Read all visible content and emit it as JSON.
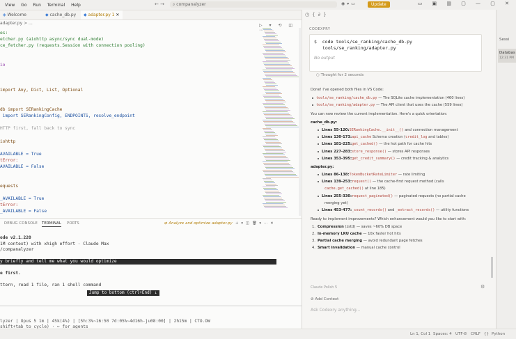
{
  "menu": [
    "View",
    "Go",
    "Run",
    "Terminal",
    "Help"
  ],
  "search_placeholder": "companalyzer",
  "update_label": "Update",
  "tabs": [
    {
      "label": "Welcome"
    },
    {
      "label": "cache_db.py"
    },
    {
      "label": "adapter.py 1",
      "active": true
    }
  ],
  "breadcrumb": "adapter.py > ...",
  "editor_lines": [
    {
      "t": "es:",
      "c": "#2e7d32"
    },
    {
      "t": "etcher.py (aiohttp async/sync dual-mode)",
      "c": "#2e7d32"
    },
    {
      "t": "ce_fetcher.py (requests.Session with connection pooling)",
      "c": "#2e7d32"
    },
    {
      "t": "",
      "c": "#333"
    },
    {
      "t": "",
      "c": "#333"
    },
    {
      "t": "io",
      "c": "#8e3aa8"
    },
    {
      "t": "",
      "c": "#333"
    },
    {
      "t": "",
      "c": "#333"
    },
    {
      "t": "",
      "c": "#333"
    },
    {
      "t": "import Any, Dict, List, Optional",
      "c": "#7b4a12"
    },
    {
      "t": "",
      "c": "#333"
    },
    {
      "t": "",
      "c": "#333"
    },
    {
      "t": "db import SERankingCache",
      "c": "#7b4a12"
    },
    {
      "t": " import SERankingConfig, ENDPOINTS, resolve_endpoint",
      "c": "#1a4fa0"
    },
    {
      "t": "",
      "c": "#333"
    },
    {
      "t": "HTTP first, fall back to sync",
      "c": "#9a9a9a"
    },
    {
      "t": "",
      "c": "#333"
    },
    {
      "t": "iohttp",
      "c": "#7b4a12"
    },
    {
      "t": "",
      "c": "#333"
    },
    {
      "t": "AVAILABLE = True",
      "c": "#1a4fa0"
    },
    {
      "t": "tError:",
      "c": "#b0443a"
    },
    {
      "t": "AVAILABLE = False",
      "c": "#1a4fa0"
    },
    {
      "t": "",
      "c": "#333"
    },
    {
      "t": "",
      "c": "#333"
    },
    {
      "t": "equests",
      "c": "#7b4a12"
    },
    {
      "t": "",
      "c": "#333"
    },
    {
      "t": "_AVAILABLE = True",
      "c": "#1a4fa0"
    },
    {
      "t": "tError:",
      "c": "#b0443a"
    },
    {
      "t": "_AVAILABLE = False",
      "c": "#1a4fa0"
    }
  ],
  "panel": {
    "tabs": [
      "DEBUG CONSOLE",
      "TERMINAL",
      "PORTS"
    ],
    "task_label": "Analyze and optimize adapter.py",
    "lines": [
      {
        "t": "ode v2.1.220",
        "b": true
      },
      {
        "t": "1M context) with xhigh effort · Claude Max"
      },
      {
        "t": "/companalyzer"
      },
      {
        "t": ""
      },
      {
        "t": "y briefly and tell me what you would optimize",
        "hl": true
      },
      {
        "t": ""
      },
      {
        "t": "e first.",
        "b": true
      },
      {
        "t": ""
      },
      {
        "t": "ttern, read 1 file, ran 1 shell command"
      }
    ],
    "jump_label": "Jump to bottom (ctrl+End) ↓",
    "status_line": "lyzer | Opus 5 1m | 45k(4%) | [5h:3%~16:50 7d:05%~4d16h-ju08:00] | 2h15m | CTO.OW",
    "hint_line": "shift+tab to cycle) · ← for agents"
  },
  "right": {
    "header": "CODEXPRY",
    "cmd": "code tools/se_ranking/cache_db.py",
    "cmd2": "tools/se_ranking/adapter.py",
    "no_output": "No output",
    "thought": "Thought for 2 seconds",
    "intro": "Done! I've opened both files in VS Code:",
    "files": [
      {
        "code": "tools/se_ranking/cache_db.py",
        "rest": " — The SQLite cache implementation (460 lines)"
      },
      {
        "code": "tools/se_ranking/adapter.py",
        "rest": " — The API client that uses the cache (559 lines)"
      }
    ],
    "review": "You can now review the current implementation. Here's a quick orientation:",
    "sec1": "cache_db.py:",
    "sec1_items": [
      {
        "a": "Lines 55-120:",
        "code": "SERankingCache.__init__()",
        "rest": " and connection management"
      },
      {
        "a": "Lines 130-173:",
        "rest": " Schema creation (",
        "code": "api_cache",
        "mid": " and ",
        "code2": "credit_log",
        "end": " tables)"
      },
      {
        "a": "Lines 181-225:",
        "code": "get_cached()",
        "rest": " — the hot path for cache hits"
      },
      {
        "a": "Lines 227-283:",
        "code": "store_response()",
        "rest": " — stores API responses"
      },
      {
        "a": "Lines 353-395:",
        "code": "get_credit_summary()",
        "rest": " — credit tracking & analytics"
      }
    ],
    "sec2": "adapter.py:",
    "sec2_items": [
      {
        "a": "Lines 86-138:",
        "code": "TokenBucketRateLimiter",
        "rest": " — rate limiting"
      },
      {
        "a": "Lines 139-253:",
        "code": "request()",
        "rest": " — the cache-first request method (calls"
      },
      {
        "a": "",
        "code": "cache.get_cached()",
        "rest": " at line 185)"
      },
      {
        "a": "Lines 255-330:",
        "code": "request_paginated()",
        "rest": " — paginated requests (no partial cache"
      },
      {
        "a": "",
        "code": "",
        "rest": "merging yet)"
      },
      {
        "a": "Lines 453-477:",
        "code": "_count_records()",
        "rest": " and ",
        "code2": "_extract_records()",
        "end": " — utility functions"
      }
    ],
    "question": "Ready to implement improvements? Which enhancement would you like to start with:",
    "options": [
      {
        "b": "Compression",
        "rest": " (zstd) — saves ~60% DB space"
      },
      {
        "b": "In-memory LRU cache",
        "rest": " — 10x faster hot hits"
      },
      {
        "b": "Partial cache merging",
        "rest": " — avoid redundant page fetches"
      },
      {
        "b": "Smart invalidation",
        "rest": " — manual cache control"
      }
    ],
    "model": "Claude Polish 5",
    "add_context": "Add Context",
    "input_placeholder": "Ask Codexry anything..."
  },
  "farright": {
    "header": "Sessi",
    "item": "Databas",
    "item_time": "12:31 PM"
  },
  "statusbar": {
    "pos": "Ln 1, Col 1",
    "spaces": "Spaces: 4",
    "enc": "UTF-8",
    "eol": "CRLF",
    "brace": "{}",
    "lang": "Python"
  }
}
